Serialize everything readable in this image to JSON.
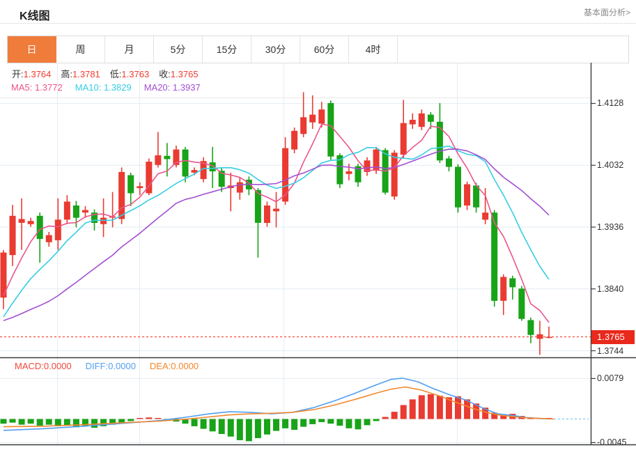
{
  "header": {
    "title": "K线图",
    "analysis_link": "基本面分析>"
  },
  "tabs": {
    "items": [
      {
        "label": "日",
        "selected": true
      },
      {
        "label": "周",
        "selected": false
      },
      {
        "label": "月",
        "selected": false
      },
      {
        "label": "5分",
        "selected": false
      },
      {
        "label": "15分",
        "selected": false
      },
      {
        "label": "30分",
        "selected": false
      },
      {
        "label": "60分",
        "selected": false
      },
      {
        "label": "4时",
        "selected": false
      }
    ]
  },
  "kline_legend": {
    "ohlc": [
      {
        "label": "开:",
        "value": "1.3764"
      },
      {
        "label": "高:",
        "value": "1.3781"
      },
      {
        "label": "低:",
        "value": "1.3763"
      },
      {
        "label": "收:",
        "value": "1.3765"
      }
    ],
    "ma": [
      {
        "label": "MA5:",
        "value": "1.3772",
        "color": "#ec548c"
      },
      {
        "label": "MA10:",
        "value": "1.3829",
        "color": "#36cde4"
      },
      {
        "label": "MA20:",
        "value": "1.3937",
        "color": "#a34fd2"
      }
    ]
  },
  "macd_legend": {
    "items": [
      {
        "label": "MACD:",
        "value": "0.0000",
        "color": "#f4473a"
      },
      {
        "label": "DIFF:",
        "value": "0.0000",
        "color": "#519ff1"
      },
      {
        "label": "DEA:",
        "value": "0.0000",
        "color": "#f1872b"
      }
    ]
  },
  "axis": {
    "price_ticks": [
      "1.4128",
      "1.4032",
      "1.3936",
      "1.3840",
      "1.3744"
    ],
    "macd_ticks": [
      "0.0079",
      "-0.0045"
    ],
    "last_price": "1.3765"
  },
  "colors": {
    "up": "#e93b31",
    "down": "#18a318",
    "badge": "#e8291c",
    "dotted_price_line": "#f43b30",
    "grid": "#e3ecf3",
    "dark_border": "#3a3a3a",
    "tab_active": "#f07c3c",
    "ma5": "#ec548c",
    "ma10": "#36cde4",
    "ma20": "#a34fd2",
    "diff_line": "#519ff1",
    "dea_line": "#f1872b",
    "zero_dash_ext": "#8fd2ec"
  },
  "chart_data": [
    {
      "type": "candlestick",
      "panel": "main",
      "title": "K线图 日线",
      "up_color": "#e93b31",
      "down_color": "#18a318",
      "y_ticks": [
        1.4128,
        1.4032,
        1.3936,
        1.384,
        1.3744
      ],
      "last_price": 1.3765,
      "grid_x": [
        82,
        200,
        407,
        656
      ],
      "candles_ohlc_order": "open,high,low,close",
      "candles": [
        [
          1.3826,
          1.39,
          1.3808,
          1.3896
        ],
        [
          1.3892,
          1.397,
          1.3875,
          1.3953
        ],
        [
          1.3942,
          1.398,
          1.39,
          1.3948
        ],
        [
          1.394,
          1.395,
          1.3936,
          1.3945
        ],
        [
          1.3953,
          1.3958,
          1.388,
          1.3917
        ],
        [
          1.3912,
          1.3928,
          1.3905,
          1.3923
        ],
        [
          1.3915,
          1.398,
          1.39,
          1.3947
        ],
        [
          1.3947,
          1.3985,
          1.394,
          1.3975
        ],
        [
          1.3969,
          1.3976,
          1.3935,
          1.395
        ],
        [
          1.3958,
          1.3968,
          1.395,
          1.3962
        ],
        [
          1.3958,
          1.3963,
          1.393,
          1.3942
        ],
        [
          1.394,
          1.398,
          1.392,
          1.395
        ],
        [
          1.395,
          1.399,
          1.3935,
          1.3952
        ],
        [
          1.3948,
          1.4028,
          1.394,
          1.4021
        ],
        [
          1.4016,
          1.402,
          1.3968,
          1.3988
        ],
        [
          1.3996,
          1.4005,
          1.3985,
          1.3999
        ],
        [
          1.3988,
          1.4042,
          1.3985,
          1.4037
        ],
        [
          1.4032,
          1.4083,
          1.4028,
          1.4047
        ],
        [
          1.4046,
          1.4066,
          1.4014,
          1.4041
        ],
        [
          1.4032,
          1.4062,
          1.4028,
          1.4056
        ],
        [
          1.4056,
          1.406,
          1.4005,
          1.4014
        ],
        [
          1.402,
          1.4028,
          1.4016,
          1.4024
        ],
        [
          1.401,
          1.4044,
          1.4005,
          1.4038
        ],
        [
          1.4036,
          1.406,
          1.3996,
          1.4022
        ],
        [
          1.4023,
          1.4028,
          1.399,
          1.3998
        ],
        [
          1.3996,
          1.402,
          1.396,
          1.4
        ],
        [
          1.3989,
          1.4012,
          1.3978,
          1.4005
        ],
        [
          1.4009,
          1.4014,
          1.3985,
          1.3994
        ],
        [
          1.3993,
          1.3996,
          1.3888,
          1.3942
        ],
        [
          1.3942,
          1.3975,
          1.3936,
          1.3969
        ],
        [
          1.396,
          1.399,
          1.3935,
          1.3964
        ],
        [
          1.3975,
          1.4075,
          1.397,
          1.4058
        ],
        [
          1.4056,
          1.409,
          1.405,
          1.4085
        ],
        [
          1.408,
          1.4145,
          1.4075,
          1.4106
        ],
        [
          1.4098,
          1.414,
          1.4088,
          1.411
        ],
        [
          1.4096,
          1.413,
          1.409,
          1.4118
        ],
        [
          1.4128,
          1.4132,
          1.404,
          1.4045
        ],
        [
          1.4047,
          1.405,
          1.3996,
          1.4002
        ],
        [
          1.4018,
          1.4034,
          1.4008,
          1.4022
        ],
        [
          1.403,
          1.4034,
          1.3998,
          1.4005
        ],
        [
          1.4021,
          1.4044,
          1.4015,
          1.4039
        ],
        [
          1.4023,
          1.406,
          1.4018,
          1.4056
        ],
        [
          1.4055,
          1.4058,
          1.3986,
          1.3989
        ],
        [
          1.3983,
          1.4055,
          1.3978,
          1.4051
        ],
        [
          1.4048,
          1.4133,
          1.4042,
          1.4097
        ],
        [
          1.4095,
          1.4112,
          1.4088,
          1.4102
        ],
        [
          1.4091,
          1.4118,
          1.4086,
          1.4112
        ],
        [
          1.411,
          1.4114,
          1.4088,
          1.4099
        ],
        [
          1.4099,
          1.4128,
          1.4035,
          1.4039
        ],
        [
          1.4042,
          1.4046,
          1.4022,
          1.4029
        ],
        [
          1.4029,
          1.4033,
          1.3958,
          1.3966
        ],
        [
          1.3969,
          1.4006,
          1.3962,
          1.4002
        ],
        [
          1.4,
          1.4004,
          1.3958,
          1.3966
        ],
        [
          1.3947,
          1.3996,
          1.394,
          1.3958
        ],
        [
          1.3958,
          1.3962,
          1.3812,
          1.3821
        ],
        [
          1.3821,
          1.3862,
          1.3799,
          1.3858
        ],
        [
          1.3856,
          1.386,
          1.3823,
          1.3842
        ],
        [
          1.384,
          1.3844,
          1.379,
          1.3793
        ],
        [
          1.3791,
          1.3795,
          1.3755,
          1.3768
        ],
        [
          1.3762,
          1.379,
          1.3737,
          1.3769
        ],
        [
          1.3764,
          1.3781,
          1.3763,
          1.3765
        ]
      ],
      "overlays": [
        {
          "name": "MA5",
          "period": 5,
          "color": "#ec548c",
          "last_value": 1.3772
        },
        {
          "name": "MA10",
          "period": 10,
          "color": "#36cde4",
          "last_value": 1.3829
        },
        {
          "name": "MA20",
          "period": 20,
          "color": "#a34fd2",
          "last_value": 1.3937
        }
      ],
      "prior_closes_for_ma": [
        1.387,
        1.385,
        1.383,
        1.3815,
        1.38,
        1.3788,
        1.3775,
        1.3762,
        1.375,
        1.374,
        1.3732,
        1.374,
        1.375,
        1.3762,
        1.3775,
        1.3788,
        1.38,
        1.381,
        1.3818,
        1.3822
      ]
    },
    {
      "type": "bar",
      "panel": "macd",
      "name": "MACD histogram",
      "positive_color": "#e93b31",
      "negative_color": "#18a318",
      "y_ticks": [
        0.0079,
        -0.0045
      ],
      "values": [
        -0.0009,
        -0.0007,
        -0.0011,
        -0.0009,
        -0.0013,
        -0.0011,
        -0.0014,
        -0.0012,
        -0.0016,
        -0.0013,
        -0.0017,
        -0.0014,
        -0.0011,
        -0.0008,
        -0.0004,
        0.0002,
        0.0003,
        0.0002,
        -0.0002,
        -0.0005,
        -0.0009,
        -0.0014,
        -0.0019,
        -0.0024,
        -0.0029,
        -0.0034,
        -0.0041,
        -0.0043,
        -0.0037,
        -0.003,
        -0.0023,
        -0.0018,
        -0.0021,
        -0.0015,
        -0.001,
        -0.0006,
        -0.0009,
        -0.0013,
        -0.0018,
        -0.002,
        -0.0012,
        -0.0004,
        0.0004,
        0.0014,
        0.0027,
        0.0038,
        0.0046,
        0.0048,
        0.0045,
        0.0042,
        0.0044,
        0.0038,
        0.003,
        0.0022,
        0.0012,
        0.0007,
        0.001,
        0.0006,
        0.0002,
        0.0001,
        0.0
      ],
      "lines": [
        {
          "name": "DIFF",
          "color": "#519ff1",
          "points": [
            [
              5,
              -0.0022
            ],
            [
              60,
              -0.0019
            ],
            [
              120,
              -0.0014
            ],
            [
              180,
              -0.0008
            ],
            [
              230,
              -0.0003
            ],
            [
              270,
              0.0004
            ],
            [
              300,
              0.001
            ],
            [
              330,
              0.0014
            ],
            [
              360,
              0.0013
            ],
            [
              390,
              0.001
            ],
            [
              420,
              0.0013
            ],
            [
              450,
              0.0022
            ],
            [
              480,
              0.0035
            ],
            [
              510,
              0.005
            ],
            [
              540,
              0.0066
            ],
            [
              562,
              0.0077
            ],
            [
              578,
              0.0079
            ],
            [
              600,
              0.0072
            ],
            [
              620,
              0.006
            ],
            [
              645,
              0.0047
            ],
            [
              670,
              0.0036
            ],
            [
              695,
              0.002
            ],
            [
              715,
              0.001
            ],
            [
              735,
              0.0007
            ],
            [
              755,
              0.0003
            ],
            [
              775,
              0.0001
            ],
            [
              790,
              0.0
            ]
          ]
        },
        {
          "name": "DEA",
          "color": "#f1872b",
          "points": [
            [
              5,
              -0.0015
            ],
            [
              60,
              -0.0014
            ],
            [
              120,
              -0.0011
            ],
            [
              180,
              -0.0007
            ],
            [
              230,
              -0.0004
            ],
            [
              270,
              0.0
            ],
            [
              300,
              0.0004
            ],
            [
              330,
              0.0008
            ],
            [
              360,
              0.001
            ],
            [
              390,
              0.0011
            ],
            [
              420,
              0.0013
            ],
            [
              450,
              0.0018
            ],
            [
              480,
              0.0027
            ],
            [
              510,
              0.0038
            ],
            [
              540,
              0.005
            ],
            [
              562,
              0.0058
            ],
            [
              582,
              0.0062
            ],
            [
              605,
              0.0056
            ],
            [
              630,
              0.0045
            ],
            [
              655,
              0.0032
            ],
            [
              680,
              0.002
            ],
            [
              700,
              0.0012
            ],
            [
              720,
              0.0007
            ],
            [
              740,
              0.0004
            ],
            [
              760,
              0.0002
            ],
            [
              780,
              0.0001
            ],
            [
              795,
              0.0
            ]
          ]
        }
      ]
    }
  ]
}
